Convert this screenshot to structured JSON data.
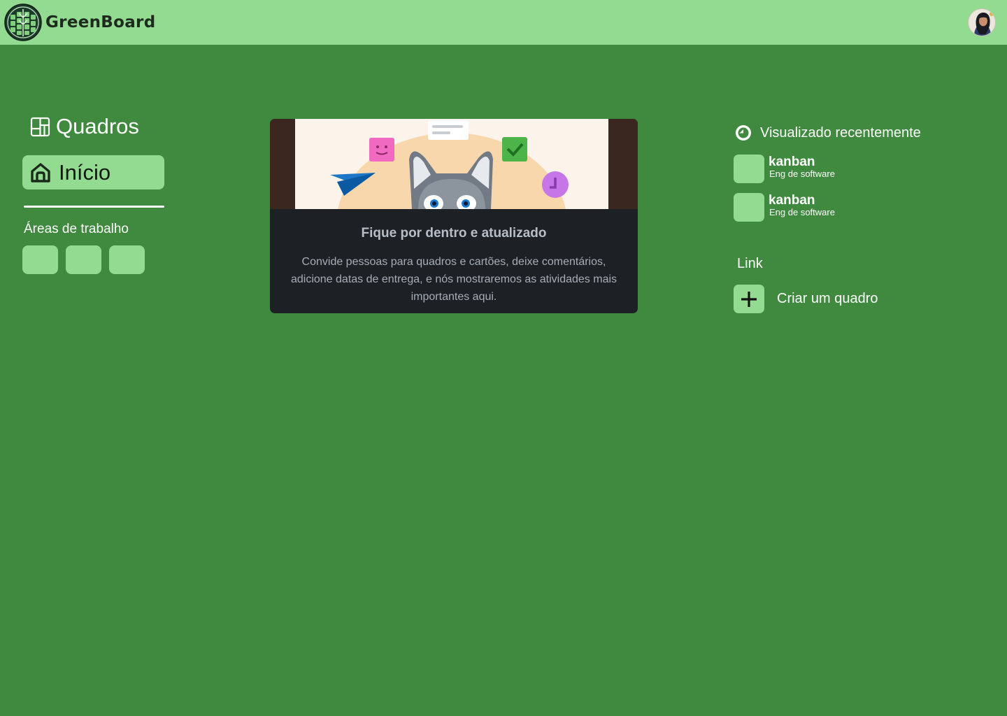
{
  "header": {
    "brand": "GreenBoard",
    "avatar_alt": "user avatar"
  },
  "sidebar": {
    "title": "Quadros",
    "home_label": "Início",
    "workspaces_heading": "Áreas de trabalho",
    "workspace_tiles": 3
  },
  "main": {
    "card_title": "Fique por dentro e atualizado",
    "card_body": "Convide pessoas para quadros e cartões, deixe comentários, adicione datas de entrega, e nós mostraremos as atividades mais importantes aqui."
  },
  "right": {
    "recent_heading": "Visualizado recentemente",
    "recent_items": [
      {
        "name": "kanban",
        "workspace": "Eng de software"
      },
      {
        "name": "kanban",
        "workspace": "Eng de software"
      }
    ],
    "link_heading": "Link",
    "create_label": "Criar um quadro"
  },
  "colors": {
    "background": "#3f8a3e",
    "header": "#93db90",
    "accent_tile": "#93db90",
    "card": "#1d2126"
  },
  "icons": [
    "greenboard-logo-icon",
    "boards-icon",
    "home-icon",
    "clock-icon",
    "plus-icon"
  ]
}
